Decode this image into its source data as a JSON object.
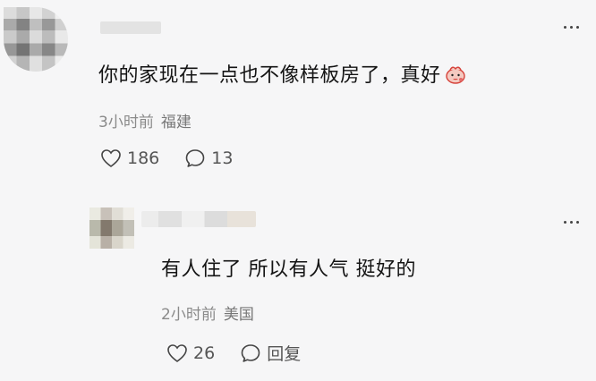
{
  "comments": [
    {
      "text": "你的家现在一点也不像样板房了，真好",
      "emoji_icon": "sticker-emoji-icon",
      "time": "3小时前",
      "location": "福建",
      "likes": "186",
      "replies": "13"
    },
    {
      "text": "有人住了 所以有人气 挺好的",
      "time": "2小时前",
      "location": "美国",
      "likes": "26",
      "reply_label": "回复"
    }
  ],
  "icons": {
    "like": "heart-icon",
    "comment": "comment-bubble-icon",
    "more": "more-dots-icon"
  },
  "colors": {
    "background": "#f6f6f7",
    "text": "#141414",
    "meta": "#8a8a8a",
    "icon": "#555555"
  }
}
